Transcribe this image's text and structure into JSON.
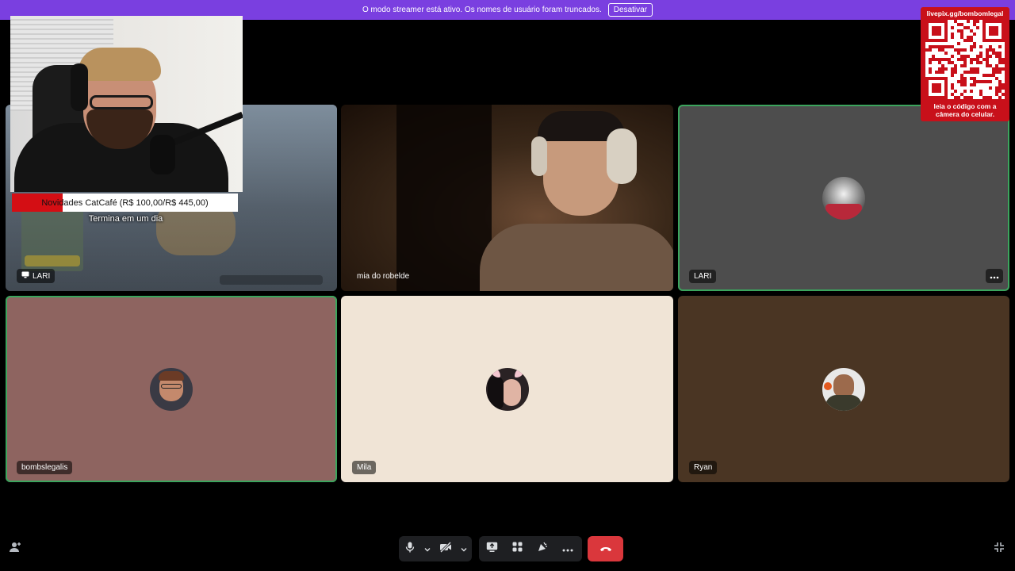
{
  "banner": {
    "message": "O modo streamer está ativo. Os nomes de usuário foram truncados.",
    "disable_label": "Desativar"
  },
  "tiles": [
    {
      "name": "LARI",
      "type": "screen-share",
      "indicator": "screen-share-icon"
    },
    {
      "name": "mia do robelde",
      "type": "camera"
    },
    {
      "name": "LARI",
      "type": "avatar",
      "speaking": true
    },
    {
      "name": "bombslegalis",
      "type": "avatar",
      "speaking": true
    },
    {
      "name": "Mila",
      "type": "avatar"
    },
    {
      "name": "Ryan",
      "type": "avatar"
    }
  ],
  "goal": {
    "label": "Novidades CatCafé (R$ 100,00/R$ 445,00)",
    "current": 100,
    "target": 445,
    "subtitle": "Termina em um dia"
  },
  "qr": {
    "url": "livepix.gg/bombomlegal",
    "caption_line1": "leia o código com a",
    "caption_line2": "câmera do celular."
  },
  "colors": {
    "banner": "#7a3fe0",
    "speaking_border": "#3ba55d",
    "hangup": "#da373c",
    "qr_background": "#c8101a",
    "goal_fill": "#d40e14"
  },
  "controls": {
    "icons": [
      "microphone-icon",
      "chevron-down-icon",
      "camera-off-icon",
      "chevron-down-icon",
      "screen-share-icon",
      "activities-icon",
      "soundboard-icon",
      "more-icon",
      "hang-up-icon"
    ],
    "left_icon": "add-user-icon",
    "right_icon": "fullscreen-exit-icon"
  }
}
